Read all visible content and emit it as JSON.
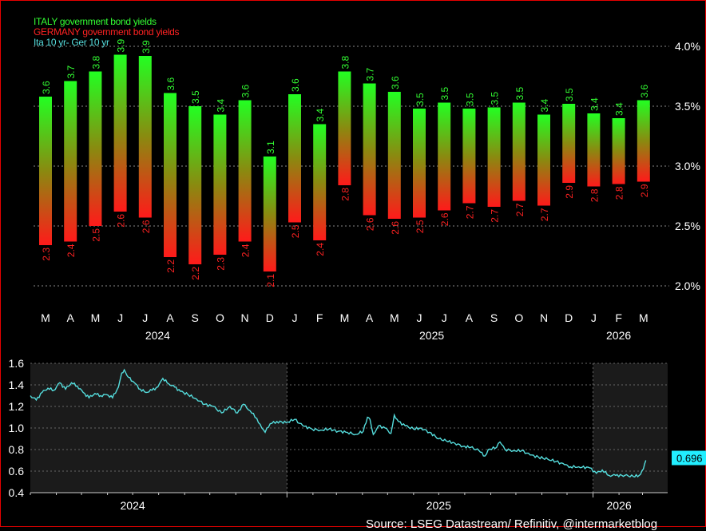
{
  "legend": {
    "italy": "ITALY government bond yields",
    "germany": "GERMANY government bond yields",
    "spread": "Ita 10 yr- Ger 10 yr"
  },
  "colors": {
    "italy": "#33ff33",
    "germany": "#ff2222",
    "spread": "#55dddd",
    "tag_bg": "#22eeff",
    "grid": "#888888",
    "border": "#e60000"
  },
  "source_text": "Source: LSEG Datastream/ Refinitiv, @intermarketblog",
  "chart_data": [
    {
      "type": "bar",
      "title": "",
      "description_series": [
        "ITALY government bond yields",
        "GERMANY government bond yields"
      ],
      "categories": [
        "M",
        "A",
        "M",
        "J",
        "J",
        "A",
        "S",
        "O",
        "N",
        "D",
        "J",
        "F",
        "M",
        "A",
        "M",
        "J",
        "J",
        "A",
        "S",
        "O",
        "N",
        "D",
        "J",
        "F",
        "M"
      ],
      "year_labels": [
        {
          "label": "2024",
          "at_index": 4.5
        },
        {
          "label": "2025",
          "at_index": 15.5
        },
        {
          "label": "2026",
          "at_index": 23
        }
      ],
      "series": [
        {
          "name": "ITALY government bond yields",
          "values": [
            3.58,
            3.71,
            3.79,
            3.93,
            3.92,
            3.61,
            3.5,
            3.43,
            3.55,
            3.08,
            3.6,
            3.35,
            3.79,
            3.69,
            3.62,
            3.48,
            3.53,
            3.48,
            3.49,
            3.53,
            3.43,
            3.52,
            3.44,
            3.4,
            3.55
          ],
          "labels": [
            "3.6",
            "3.7",
            "3.8",
            "3.9",
            "3.9",
            "3.6",
            "3.5",
            "3.4",
            "3.6",
            "3.1",
            "3.6",
            "3.4",
            "3.8",
            "3.7",
            "3.6",
            "3.5",
            "3.5",
            "3.5",
            "3.5",
            "3.5",
            "3.4",
            "3.5",
            "3.4",
            "3.4",
            "3.6"
          ]
        },
        {
          "name": "GERMANY government bond yields",
          "values": [
            2.34,
            2.37,
            2.5,
            2.62,
            2.57,
            2.24,
            2.18,
            2.26,
            2.37,
            2.12,
            2.53,
            2.38,
            2.84,
            2.59,
            2.56,
            2.57,
            2.63,
            2.69,
            2.66,
            2.71,
            2.67,
            2.86,
            2.83,
            2.85,
            2.87
          ],
          "labels": [
            "2.3",
            "2.4",
            "2.5",
            "2.6",
            "2.6",
            "2.2",
            "2.2",
            "2.3",
            "2.4",
            "2.1",
            "2.5",
            "2.4",
            "2.8",
            "2.6",
            "2.6",
            "2.5",
            "2.6",
            "2.7",
            "2.7",
            "2.7",
            "2.7",
            "2.9",
            "2.8",
            "2.8",
            "2.9"
          ]
        }
      ],
      "ylim": [
        1.85,
        4.15
      ],
      "yticks": [
        2.0,
        2.5,
        3.0,
        3.5,
        4.0
      ],
      "ytick_labels": [
        "2.0%",
        "2.5%",
        "3.0%",
        "3.5%",
        "4.0%"
      ],
      "grid": true
    },
    {
      "type": "line",
      "series": [
        {
          "name": "Ita 10 yr- Ger 10 yr"
        }
      ],
      "ylim": [
        0.4,
        1.6
      ],
      "yticks": [
        0.4,
        0.6,
        0.8,
        1.0,
        1.2,
        1.4,
        1.6
      ],
      "ytick_labels": [
        "0.4",
        "0.6",
        "0.8",
        "1.0",
        "1.2",
        "1.4",
        "1.6"
      ],
      "xlim": [
        "2024-03-01",
        "2026-03-31"
      ],
      "x_labels": [
        {
          "label": "2024",
          "date": "2024-07-01"
        },
        {
          "label": "2025",
          "date": "2025-07-01"
        },
        {
          "label": "2026",
          "date": "2026-02-01"
        }
      ],
      "year_dividers": [
        "2025-01-01",
        "2026-01-01"
      ],
      "last_value_label": "0.696",
      "points": [
        [
          "2024-03-01",
          1.3
        ],
        [
          "2024-03-08",
          1.26
        ],
        [
          "2024-03-15",
          1.33
        ],
        [
          "2024-03-22",
          1.37
        ],
        [
          "2024-03-29",
          1.35
        ],
        [
          "2024-04-05",
          1.42
        ],
        [
          "2024-04-12",
          1.36
        ],
        [
          "2024-04-19",
          1.42
        ],
        [
          "2024-04-26",
          1.39
        ],
        [
          "2024-05-03",
          1.33
        ],
        [
          "2024-05-10",
          1.28
        ],
        [
          "2024-05-17",
          1.32
        ],
        [
          "2024-05-24",
          1.3
        ],
        [
          "2024-05-31",
          1.31
        ],
        [
          "2024-06-07",
          1.28
        ],
        [
          "2024-06-14",
          1.38
        ],
        [
          "2024-06-18",
          1.51
        ],
        [
          "2024-06-21",
          1.54
        ],
        [
          "2024-06-26",
          1.47
        ],
        [
          "2024-07-03",
          1.42
        ],
        [
          "2024-07-10",
          1.36
        ],
        [
          "2024-07-17",
          1.33
        ],
        [
          "2024-07-24",
          1.35
        ],
        [
          "2024-07-31",
          1.38
        ],
        [
          "2024-08-06",
          1.46
        ],
        [
          "2024-08-13",
          1.41
        ],
        [
          "2024-08-20",
          1.38
        ],
        [
          "2024-08-27",
          1.34
        ],
        [
          "2024-09-05",
          1.31
        ],
        [
          "2024-09-15",
          1.27
        ],
        [
          "2024-09-25",
          1.22
        ],
        [
          "2024-10-05",
          1.2
        ],
        [
          "2024-10-15",
          1.14
        ],
        [
          "2024-10-25",
          1.2
        ],
        [
          "2024-11-03",
          1.14
        ],
        [
          "2024-11-10",
          1.22
        ],
        [
          "2024-11-18",
          1.16
        ],
        [
          "2024-11-26",
          1.09
        ],
        [
          "2024-12-02",
          1.0
        ],
        [
          "2024-12-06",
          0.96
        ],
        [
          "2024-12-12",
          1.04
        ],
        [
          "2024-12-20",
          1.06
        ],
        [
          "2024-12-31",
          1.05
        ],
        [
          "2025-01-10",
          1.08
        ],
        [
          "2025-01-20",
          1.02
        ],
        [
          "2025-01-31",
          0.99
        ],
        [
          "2025-02-10",
          0.98
        ],
        [
          "2025-02-20",
          0.99
        ],
        [
          "2025-03-03",
          0.97
        ],
        [
          "2025-03-14",
          0.96
        ],
        [
          "2025-03-24",
          0.94
        ],
        [
          "2025-04-02",
          0.97
        ],
        [
          "2025-04-07",
          1.1
        ],
        [
          "2025-04-10",
          1.08
        ],
        [
          "2025-04-14",
          0.94
        ],
        [
          "2025-04-20",
          1.02
        ],
        [
          "2025-04-28",
          1.0
        ],
        [
          "2025-05-05",
          0.95
        ],
        [
          "2025-05-09",
          1.12
        ],
        [
          "2025-05-14",
          1.06
        ],
        [
          "2025-05-22",
          1.02
        ],
        [
          "2025-06-01",
          0.99
        ],
        [
          "2025-06-10",
          1.0
        ],
        [
          "2025-06-20",
          0.96
        ],
        [
          "2025-07-01",
          0.9
        ],
        [
          "2025-07-10",
          0.88
        ],
        [
          "2025-07-20",
          0.86
        ],
        [
          "2025-07-30",
          0.83
        ],
        [
          "2025-08-08",
          0.82
        ],
        [
          "2025-08-18",
          0.79
        ],
        [
          "2025-08-25",
          0.74
        ],
        [
          "2025-08-29",
          0.8
        ],
        [
          "2025-09-08",
          0.82
        ],
        [
          "2025-09-12",
          0.87
        ],
        [
          "2025-09-18",
          0.8
        ],
        [
          "2025-09-28",
          0.79
        ],
        [
          "2025-10-08",
          0.79
        ],
        [
          "2025-10-18",
          0.75
        ],
        [
          "2025-10-28",
          0.73
        ],
        [
          "2025-11-08",
          0.71
        ],
        [
          "2025-11-18",
          0.69
        ],
        [
          "2025-11-28",
          0.66
        ],
        [
          "2025-12-05",
          0.64
        ],
        [
          "2025-12-15",
          0.64
        ],
        [
          "2025-12-28",
          0.63
        ],
        [
          "2026-01-05",
          0.58
        ],
        [
          "2026-01-12",
          0.61
        ],
        [
          "2026-01-20",
          0.56
        ],
        [
          "2026-01-28",
          0.56
        ],
        [
          "2026-02-08",
          0.56
        ],
        [
          "2026-02-18",
          0.55
        ],
        [
          "2026-02-25",
          0.56
        ],
        [
          "2026-03-02",
          0.62
        ],
        [
          "2026-03-05",
          0.7
        ]
      ]
    }
  ]
}
